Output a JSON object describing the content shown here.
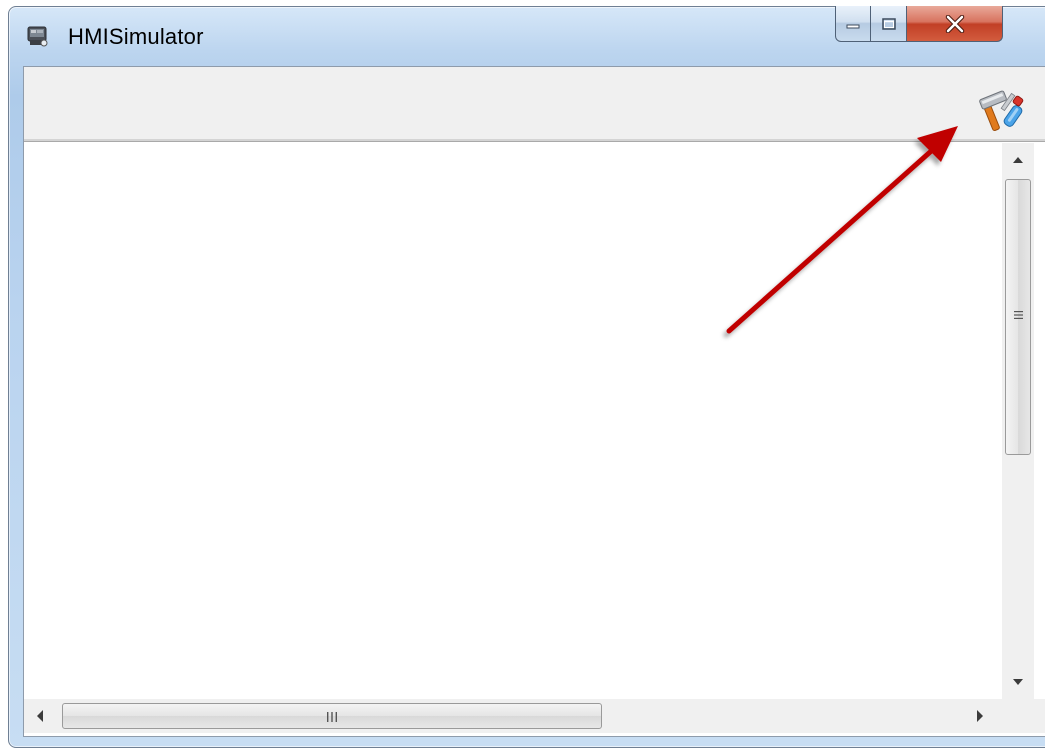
{
  "window": {
    "title": "HMISimulator",
    "app_icon": "hmi-simulator-app-icon",
    "caption_buttons": [
      {
        "name": "minimize",
        "icon": "minimize-icon"
      },
      {
        "name": "maximize",
        "icon": "maximize-icon"
      },
      {
        "name": "close",
        "icon": "close-icon"
      }
    ]
  },
  "toolbar": {
    "tools_button_icon": "tools-hammer-screwdriver-icon"
  },
  "scrollbars": {
    "vertical": {
      "position": 0,
      "thumb_fraction": 0.5
    },
    "horizontal": {
      "position": 0,
      "thumb_fraction": 0.55
    },
    "horizontal_grip_glyph": "III"
  },
  "annotation": {
    "type": "arrow",
    "color": "#c00000",
    "points_to": "tools-button"
  }
}
